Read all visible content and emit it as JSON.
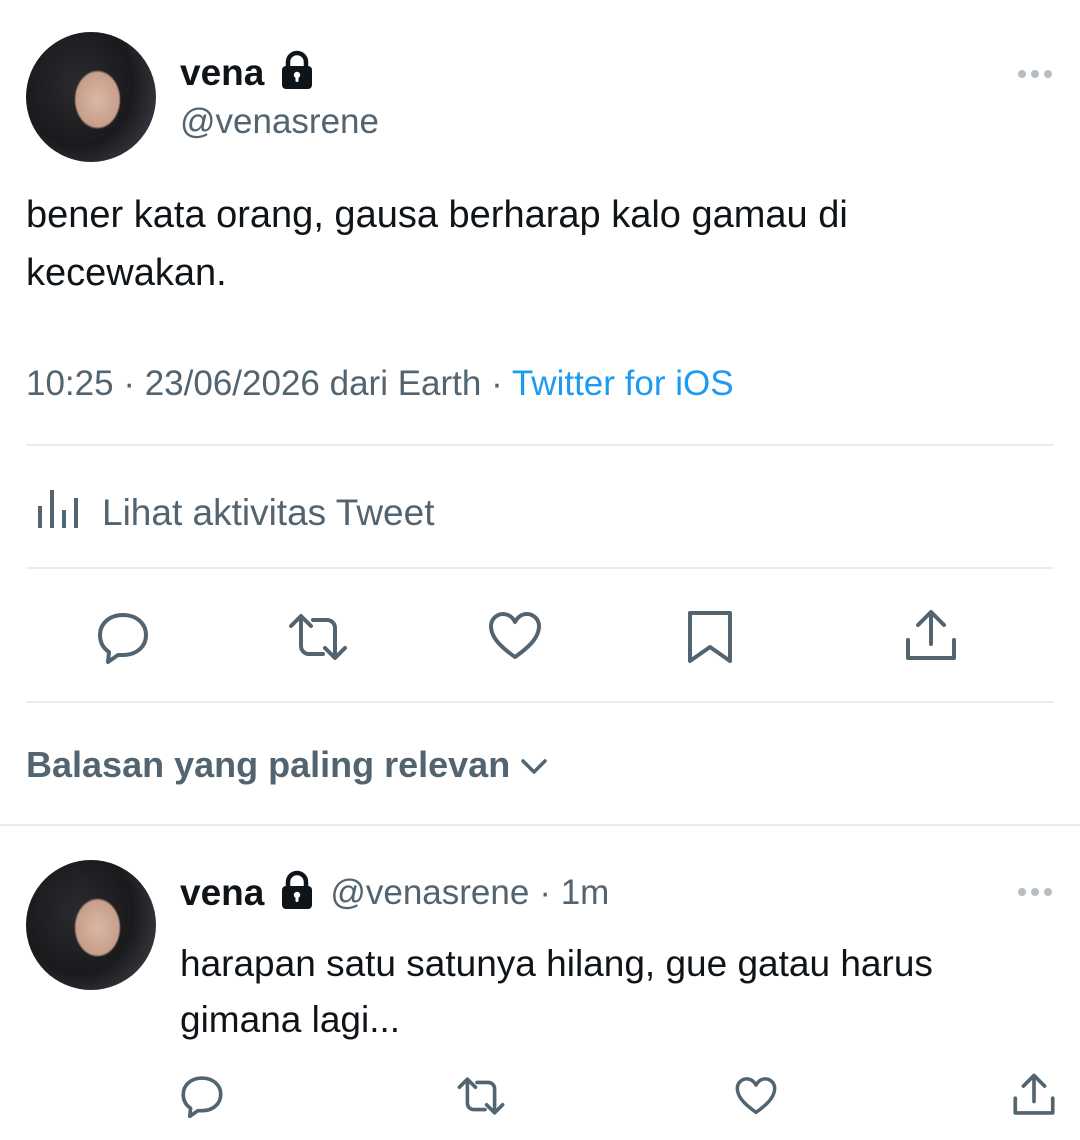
{
  "tweet": {
    "display_name": "vena",
    "handle": "@venasrene",
    "text": "bener kata orang, gausa berharap kalo gamau di kecewakan.",
    "time": "10:25",
    "date": "23/06/2026",
    "location": "dari Earth",
    "source": "Twitter for iOS",
    "activity_label": "Lihat aktivitas Tweet"
  },
  "icons": {
    "more": "more-dots-icon",
    "lock": "lock-icon",
    "analytics": "bar-chart-icon",
    "reply": "reply-bubble-icon",
    "retweet": "retweet-icon",
    "like": "heart-icon",
    "bookmark": "bookmark-icon",
    "share": "share-upload-icon",
    "chevron": "chevron-down-icon"
  },
  "replies": {
    "sort_label": "Balasan yang paling relevan",
    "items": [
      {
        "display_name": "vena",
        "handle": "@venasrene",
        "time_ago": "· 1m",
        "text": "harapan satu satunya hilang, gue gatau harus gimana lagi..."
      }
    ]
  },
  "colors": {
    "accent": "#1d9bf0",
    "secondary_text": "#536471",
    "divider": "#e6ecf0"
  }
}
